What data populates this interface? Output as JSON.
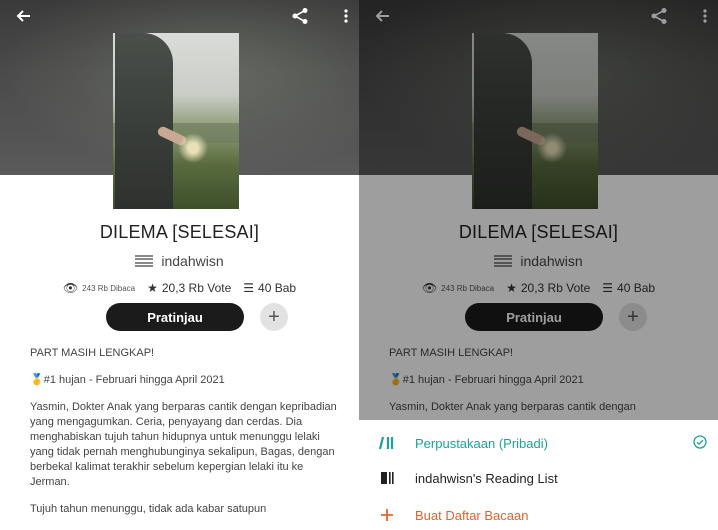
{
  "book": {
    "title": "DILEMA [SELESAI]",
    "author": "indahwisn",
    "reads_value": "243 Rb Dibaca",
    "votes": "20,3 Rb Vote",
    "parts": "40 Bab",
    "preview_label": "Pratinjau",
    "add_label": "+"
  },
  "description_left": [
    "PART MASIH LENGKAP!",
    "🥇#1 hujan - Februari hingga April 2021",
    "Yasmin, Dokter Anak yang berparas cantik dengan kepribadian yang mengagumkan. Ceria, penyayang dan cerdas. Dia menghabiskan tujuh tahun hidupnya untuk menunggu lelaki yang tidak pernah menghubunginya sekalipun, Bagas, dengan berbekal kalimat terakhir sebelum kepergian lelaki itu ke Jerman.",
    "Tujuh tahun menunggu, tidak ada kabar satupun"
  ],
  "description_right": [
    "PART MASIH LENGKAP!",
    "🥇#1 hujan - Februari hingga April 2021",
    "Yasmin, Dokter Anak yang berparas cantik dengan"
  ],
  "sheet": {
    "items": [
      {
        "label": "Perpustakaan (Pribadi)",
        "icon": "library-icon"
      },
      {
        "label": "indahwisn's Reading List",
        "icon": "reading-list-icon"
      },
      {
        "label": "Buat Daftar Bacaan",
        "icon": "plus-icon"
      }
    ]
  },
  "colors": {
    "accent_teal": "#1aa39a",
    "accent_orange": "#e3632a",
    "button_dark": "#1b1b1b"
  }
}
